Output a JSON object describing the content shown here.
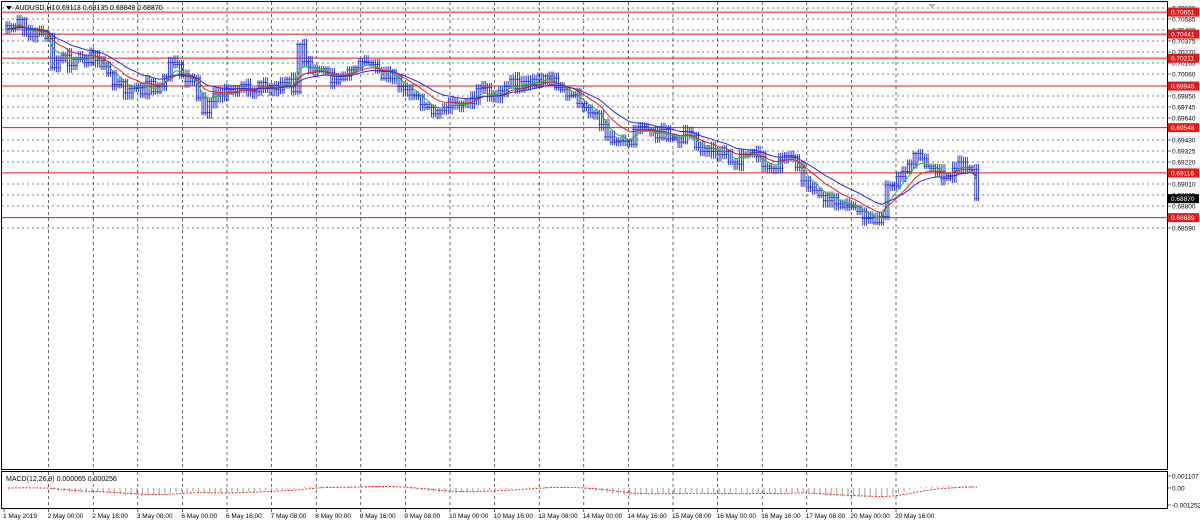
{
  "header": {
    "symbol": "AUDUSD,H1",
    "ohlc": "0.69113 0.69135 0.68849 0.68870"
  },
  "macd": {
    "label": "MACD(12,26,9) 0.000065 0.000256",
    "ticks": [
      "0.001107",
      "0.00",
      "-0.001252"
    ]
  },
  "chart_data": {
    "type": "candlestick",
    "symbol": "AUDUSD",
    "timeframe": "H1",
    "price_ticks": [
      "0.70690",
      "0.70585",
      "0.70480",
      "0.70375",
      "0.70270",
      "0.70165",
      "0.70060",
      "0.69850",
      "0.69745",
      "0.69640",
      "0.69430",
      "0.69325",
      "0.69220",
      "0.69010",
      "0.68905",
      "0.68800",
      "0.68590"
    ],
    "level_labels": [
      "0.70651",
      "0.70441",
      "0.70211",
      "0.69945",
      "0.69548",
      "0.69116",
      "0.68689"
    ],
    "current_price": "0.68870",
    "time_labels": [
      "1 May 2019",
      "2 May 00:00",
      "2 May 16:00",
      "3 May 08:00",
      "6 May 00:00",
      "6 May 16:00",
      "7 May 08:00",
      "8 May 00:00",
      "8 May 16:00",
      "9 May 08:00",
      "10 May 00:00",
      "10 May 16:00",
      "13 May 08:00",
      "14 May 00:00",
      "14 May 16:00",
      "15 May 08:00",
      "16 May 00:00",
      "16 May 16:00",
      "17 May 08:00",
      "20 May 00:00",
      "20 May 16:00"
    ],
    "close": [
      0.7049,
      0.7052,
      0.7058,
      0.7048,
      0.7042,
      0.7047,
      0.7044,
      0.704,
      0.7012,
      0.7019,
      0.7024,
      0.7014,
      0.702,
      0.7021,
      0.7017,
      0.7026,
      0.7019,
      0.7013,
      0.7007,
      0.6996,
      0.6999,
      0.6988,
      0.6992,
      0.6993,
      0.6987,
      0.6999,
      0.6989,
      0.6994,
      0.7004,
      0.7017,
      0.7015,
      0.7006,
      0.6999,
      0.7002,
      0.6983,
      0.6969,
      0.698,
      0.6987,
      0.6985,
      0.6991,
      0.6988,
      0.6992,
      0.6996,
      0.699,
      0.6989,
      0.6998,
      0.6992,
      0.6995,
      0.6991,
      0.6998,
      0.7001,
      0.6989,
      0.7034,
      0.7018,
      0.7012,
      0.7009,
      0.7011,
      0.7007,
      0.6998,
      0.7001,
      0.7004,
      0.701,
      0.7012,
      0.7018,
      0.7017,
      0.7015,
      0.7009,
      0.7002,
      0.7009,
      0.7002,
      0.6994,
      0.6991,
      0.6986,
      0.6985,
      0.6977,
      0.6974,
      0.6968,
      0.6971,
      0.6974,
      0.6979,
      0.6976,
      0.6978,
      0.6978,
      0.6983,
      0.6992,
      0.6993,
      0.6985,
      0.6985,
      0.699,
      0.6994,
      0.7001,
      0.6992,
      0.6999,
      0.6996,
      0.7001,
      0.6998,
      0.7004,
      0.7002,
      0.6993,
      0.6991,
      0.6985,
      0.6986,
      0.6978,
      0.6974,
      0.6969,
      0.6968,
      0.6958,
      0.6946,
      0.6941,
      0.6942,
      0.6942,
      0.6939,
      0.6953,
      0.6956,
      0.6953,
      0.6952,
      0.6945,
      0.6953,
      0.6944,
      0.6945,
      0.6941,
      0.6951,
      0.6947,
      0.6936,
      0.6932,
      0.6935,
      0.6932,
      0.6929,
      0.6932,
      0.6922,
      0.692,
      0.6929,
      0.6929,
      0.6931,
      0.6927,
      0.6918,
      0.6916,
      0.6916,
      0.6924,
      0.6928,
      0.6927,
      0.6917,
      0.6904,
      0.6898,
      0.6895,
      0.689,
      0.6885,
      0.6888,
      0.6882,
      0.6879,
      0.6881,
      0.6879,
      0.6875,
      0.6868,
      0.6869,
      0.6864,
      0.687,
      0.69,
      0.6899,
      0.6908,
      0.6913,
      0.692,
      0.693,
      0.6925,
      0.6918,
      0.6916,
      0.6913,
      0.6906,
      0.6909,
      0.6916,
      0.6922,
      0.6917,
      0.6915,
      0.6887
    ]
  }
}
